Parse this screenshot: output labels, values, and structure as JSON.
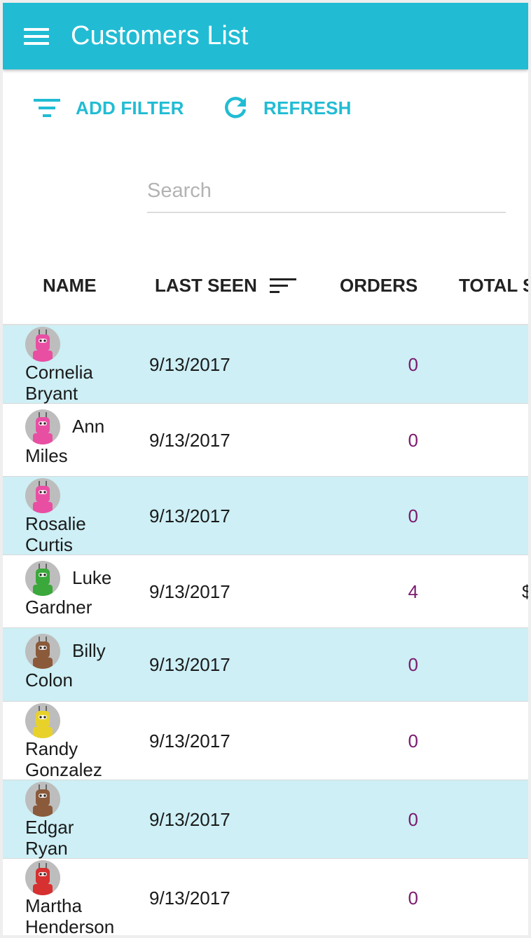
{
  "appbar": {
    "title": "Customers List",
    "color": "#21bcd4"
  },
  "toolbar": {
    "add_filter_label": "ADD FILTER",
    "refresh_label": "REFRESH"
  },
  "search": {
    "placeholder": "Search",
    "value": ""
  },
  "table": {
    "columns": {
      "name": "NAME",
      "last_seen": "LAST SEEN",
      "orders": "ORDERS",
      "total": "TOTAL S"
    },
    "sorted_by": "last_seen",
    "rows": [
      {
        "first": "Cornelia",
        "last": "Bryant",
        "last_seen": "9/13/2017",
        "orders": "0",
        "total": "",
        "avatar_color": "#e84fa3",
        "layout": "stacked"
      },
      {
        "first": "Ann",
        "last": "Miles",
        "last_seen": "9/13/2017",
        "orders": "0",
        "total": "",
        "avatar_color": "#e84fa3",
        "layout": "inline"
      },
      {
        "first": "Rosalie",
        "last": "Curtis",
        "last_seen": "9/13/2017",
        "orders": "0",
        "total": "",
        "avatar_color": "#e84fa3",
        "layout": "stacked"
      },
      {
        "first": "Luke",
        "last": "Gardner",
        "last_seen": "9/13/2017",
        "orders": "4",
        "total": "$",
        "avatar_color": "#3aa83a",
        "layout": "inline"
      },
      {
        "first": "Billy",
        "last": "Colon",
        "last_seen": "9/13/2017",
        "orders": "0",
        "total": "",
        "avatar_color": "#8a5a3a",
        "layout": "inline"
      },
      {
        "first": "Randy",
        "last": "Gonzalez",
        "last_seen": "9/13/2017",
        "orders": "0",
        "total": "",
        "avatar_color": "#e8d22a",
        "layout": "stacked"
      },
      {
        "first": "Edgar",
        "last": "Ryan",
        "last_seen": "9/13/2017",
        "orders": "0",
        "total": "",
        "avatar_color": "#8a5a3a",
        "layout": "stacked"
      },
      {
        "first": "Martha",
        "last": "Henderson",
        "last_seen": "9/13/2017",
        "orders": "0",
        "total": "",
        "avatar_color": "#d63030",
        "layout": "stacked"
      }
    ]
  }
}
